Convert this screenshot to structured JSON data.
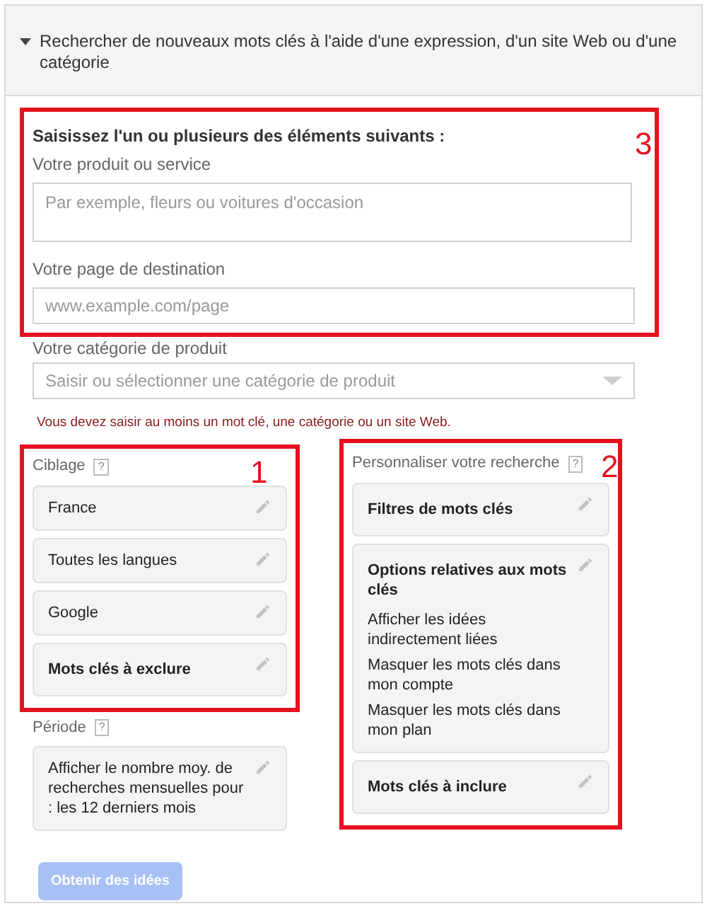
{
  "header": {
    "expanded": true,
    "title": "Rechercher de nouveaux mots clés à l'aide d'une expression, d'un site Web ou d'une catégorie"
  },
  "form": {
    "annotation": "3",
    "intro": "Saisissez l'un ou plusieurs des éléments suivants :",
    "product": {
      "label": "Votre produit ou service",
      "placeholder": "Par exemple, fleurs ou voitures d'occasion"
    },
    "page": {
      "label": "Votre page de destination",
      "placeholder": "www.example.com/page"
    },
    "category": {
      "label": "Votre catégorie de produit",
      "placeholder": "Saisir ou sélectionner une catégorie de produit"
    },
    "error": "Vous devez saisir au moins un mot clé, une catégorie ou un site Web."
  },
  "targeting": {
    "annotation": "1",
    "title": "Ciblage",
    "help": "?",
    "items": [
      {
        "kind": "value",
        "lines": [
          "France"
        ]
      },
      {
        "kind": "value",
        "lines": [
          "Toutes les langues"
        ]
      },
      {
        "kind": "value",
        "lines": [
          "Google"
        ]
      },
      {
        "kind": "heading",
        "lines": [
          "Mots clés à exclure"
        ]
      }
    ]
  },
  "period": {
    "title": "Période",
    "help": "?",
    "items": [
      {
        "kind": "value",
        "lines": [
          "Afficher le nombre moy. de recherches mensuelles pour : les 12 derniers mois"
        ]
      }
    ]
  },
  "customize": {
    "annotation": "2",
    "title": "Personnaliser votre recherche",
    "help": "?",
    "items": [
      {
        "kind": "heading",
        "lines": [
          "Filtres de mots clés"
        ]
      },
      {
        "kind": "heading",
        "lines": [
          "Options relatives aux mots clés",
          "Afficher les idées indirectement liées",
          "Masquer les mots clés dans mon compte",
          "Masquer les mots clés dans mon plan"
        ]
      },
      {
        "kind": "heading",
        "lines": [
          "Mots clés à inclure"
        ]
      }
    ]
  },
  "button": {
    "label": "Obtenir des idées",
    "disabled": true
  }
}
